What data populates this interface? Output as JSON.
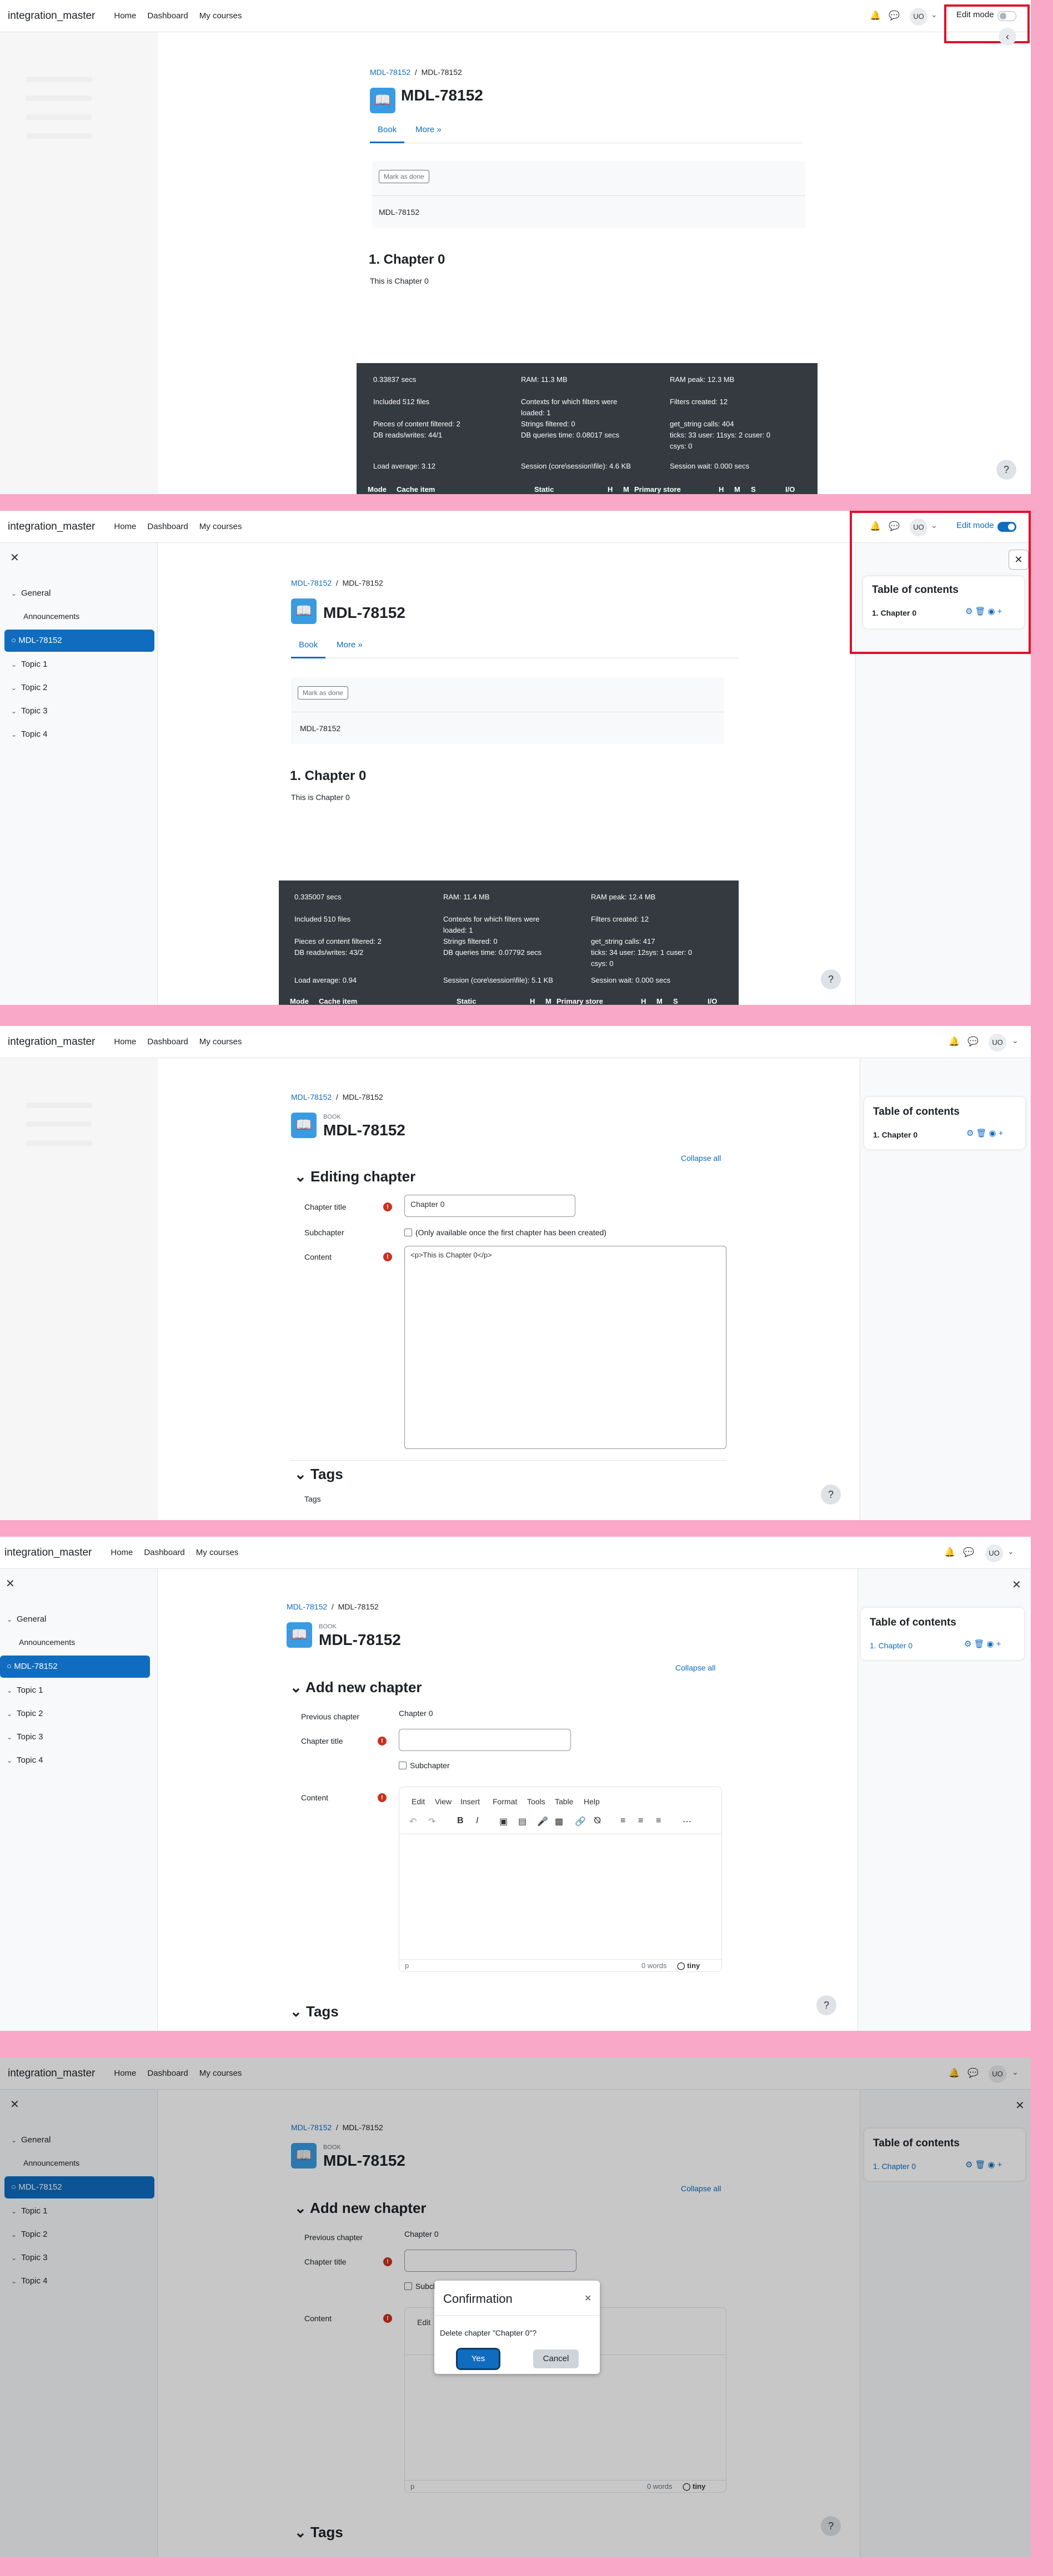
{
  "site": {
    "brand": "integration_master",
    "nav": [
      "Home",
      "Dashboard",
      "My courses"
    ],
    "avatar": "UO",
    "edit_mode": "Edit mode"
  },
  "course": {
    "breadcrumb_parent": "MDL-78152",
    "breadcrumb_current": "MDL-78152",
    "module_type": "BOOK",
    "title": "MDL-78152"
  },
  "tabs": {
    "book": "Book",
    "more": "More »"
  },
  "completion": {
    "mark_done": "Mark as done",
    "section": "MDL-78152"
  },
  "chapter": {
    "heading": "1. Chapter 0",
    "text": "This is Chapter 0"
  },
  "drawer": {
    "general": "General",
    "announcements": "Announcements",
    "active": "MDL-78152",
    "topics": [
      "Topic 1",
      "Topic 2",
      "Topic 3",
      "Topic 4"
    ]
  },
  "perf1": {
    "c1": [
      "0.33837 secs",
      "Included 512 files",
      "Pieces of content filtered: 2",
      "DB reads/writes: 44/1",
      "Load average: 3.12"
    ],
    "c2": [
      "RAM: 11.3 MB",
      "Contexts for which filters were",
      "loaded: 1",
      "Strings filtered: 0",
      "DB queries time: 0.08017 secs",
      "Session (core\\session\\file): 4.6 KB"
    ],
    "c3": [
      "RAM peak: 12.3 MB",
      "Filters created: 12",
      "get_string calls: 404",
      "ticks: 33 user: 11sys: 2 cuser: 0",
      "csys: 0",
      "Session wait: 0.000 secs"
    ],
    "header": [
      "Mode",
      "Cache item",
      "Static",
      "H",
      "M",
      "Primary store",
      "H",
      "M",
      "S",
      "I/O"
    ]
  },
  "perf2": {
    "c1": [
      "0.335007 secs",
      "Included 510 files",
      "Pieces of content filtered: 2",
      "DB reads/writes: 43/2",
      "Load average: 0.94"
    ],
    "c2": [
      "RAM: 11.4 MB",
      "Contexts for which filters were",
      "loaded: 1",
      "Strings filtered: 0",
      "DB queries time: 0.07792 secs",
      "Session (core\\session\\file): 5.1 KB"
    ],
    "c3": [
      "RAM peak: 12.4 MB",
      "Filters created: 12",
      "get_string calls: 417",
      "ticks: 34 user: 12sys: 1 cuser: 0",
      "csys: 0",
      "Session wait: 0.000 secs"
    ],
    "header": [
      "Mode",
      "Cache item",
      "Static",
      "H",
      "M",
      "Primary store",
      "H",
      "M",
      "S",
      "I/O"
    ]
  },
  "toc": {
    "heading": "Table of contents",
    "item": "1. Chapter 0"
  },
  "editing": {
    "heading": "Editing chapter",
    "collapse_all": "Collapse all",
    "chapter_title_label": "Chapter title",
    "chapter_title_value": "Chapter 0",
    "subchapter_label": "Subchapter",
    "subchapter_note": "(Only available once the first chapter has been created)",
    "content_label": "Content",
    "content_value": "<p>This is Chapter 0</p>",
    "tags_heading": "Tags",
    "tags_label": "Tags"
  },
  "addnew": {
    "heading": "Add new chapter",
    "previous_label": "Previous chapter",
    "previous_value": "Chapter 0",
    "chapter_title_label": "Chapter title",
    "subchapter_label": "Subchapter",
    "content_label": "Content",
    "menus": [
      "Edit",
      "View",
      "Insert",
      "Format",
      "Tools",
      "Table",
      "Help"
    ],
    "status_path": "p",
    "words": "0 words",
    "tiny": "tiny",
    "tags_heading": "Tags"
  },
  "modal": {
    "title": "Confirmation",
    "body": "Delete chapter \"Chapter 0\"?",
    "yes": "Yes",
    "cancel": "Cancel"
  },
  "help": "?"
}
